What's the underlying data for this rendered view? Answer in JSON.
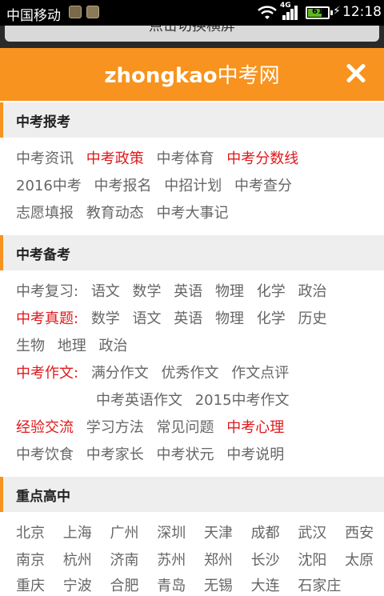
{
  "status": {
    "carrier": "中国移动",
    "network": "4G",
    "battery": "61",
    "time": "12:18"
  },
  "backdrop": {
    "hint": "点击切换横屏"
  },
  "header": {
    "logo_en": "zhongkao",
    "logo_cn": "中考网"
  },
  "sec1": {
    "title": "中考报考",
    "row1": [
      "中考资讯",
      "中考政策",
      "中考体育",
      "中考分数线"
    ],
    "row2": [
      "2016中考",
      "中考报名",
      "中招计划",
      "中考查分"
    ],
    "row3": [
      "志愿填报",
      "教育动态",
      "中考大事记"
    ]
  },
  "sec2": {
    "title": "中考备考",
    "fuxi_label": "中考复习:",
    "fuxi": [
      "语文",
      "数学",
      "英语",
      "物理",
      "化学",
      "政治"
    ],
    "zhenti_label": "中考真题:",
    "zhenti": [
      "数学",
      "语文",
      "英语",
      "物理",
      "化学",
      "历史"
    ],
    "zhenti2": [
      "生物",
      "地理",
      "政治"
    ],
    "zuowen_label": "中考作文:",
    "zuowen": [
      "满分作文",
      "优秀作文",
      "作文点评"
    ],
    "zuowen2": [
      "中考英语作文",
      "2015中考作文"
    ],
    "misc1": [
      "经验交流",
      "学习方法",
      "常见问题",
      "中考心理"
    ],
    "misc2": [
      "中考饮食",
      "中考家长",
      "中考状元",
      "中考说明"
    ]
  },
  "sec3": {
    "title": "重点高中",
    "row1": [
      "北京",
      "上海",
      "广州",
      "深圳",
      "天津",
      "成都",
      "武汉",
      "西安"
    ],
    "row2": [
      "南京",
      "杭州",
      "济南",
      "苏州",
      "郑州",
      "长沙",
      "沈阳",
      "太原"
    ],
    "row3": [
      "重庆",
      "宁波",
      "合肥",
      "青岛",
      "无锡",
      "大连",
      "石家庄"
    ]
  },
  "colors": {
    "accent": "#f7931e",
    "highlight": "#e0191c",
    "text": "#666666"
  }
}
